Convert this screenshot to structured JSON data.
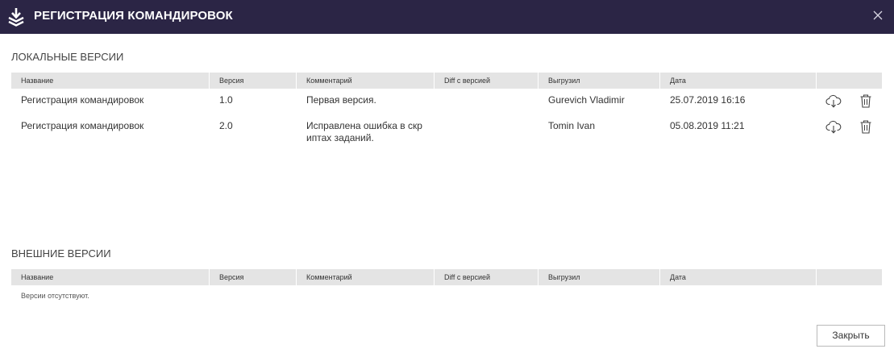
{
  "header": {
    "title": "РЕГИСТРАЦИЯ КОМАНДИРОВОК",
    "icon": "download-stack-icon",
    "background": "#2b2545"
  },
  "local": {
    "title": "ЛОКАЛЬНЫЕ ВЕРСИИ",
    "columns": [
      "Название",
      "Версия",
      "Комментарий",
      "Diff с версией",
      "Выгрузил",
      "Дата",
      ""
    ],
    "rows": [
      {
        "name": "Регистрация командировок",
        "version": "1.0",
        "comment_line1": "Первая версия.",
        "comment_line2": "",
        "diff": "",
        "uploaded_by": "Gurevich Vladimir",
        "date": "25.07.2019 16:16"
      },
      {
        "name": "Регистрация командировок",
        "version": "2.0",
        "comment_line1": "Исправлена ошибка в скр",
        "comment_line2": "иптах заданий.",
        "diff": "",
        "uploaded_by": "Tomin Ivan",
        "date": "05.08.2019 11:21"
      }
    ]
  },
  "external": {
    "title": "ВНЕШНИЕ ВЕРСИИ",
    "columns": [
      "Название",
      "Версия",
      "Комментарий",
      "Diff с версией",
      "Выгрузил",
      "Дата",
      ""
    ],
    "empty_text": "Версии отсутствуют."
  },
  "footer": {
    "close_label": "Закрыть"
  }
}
